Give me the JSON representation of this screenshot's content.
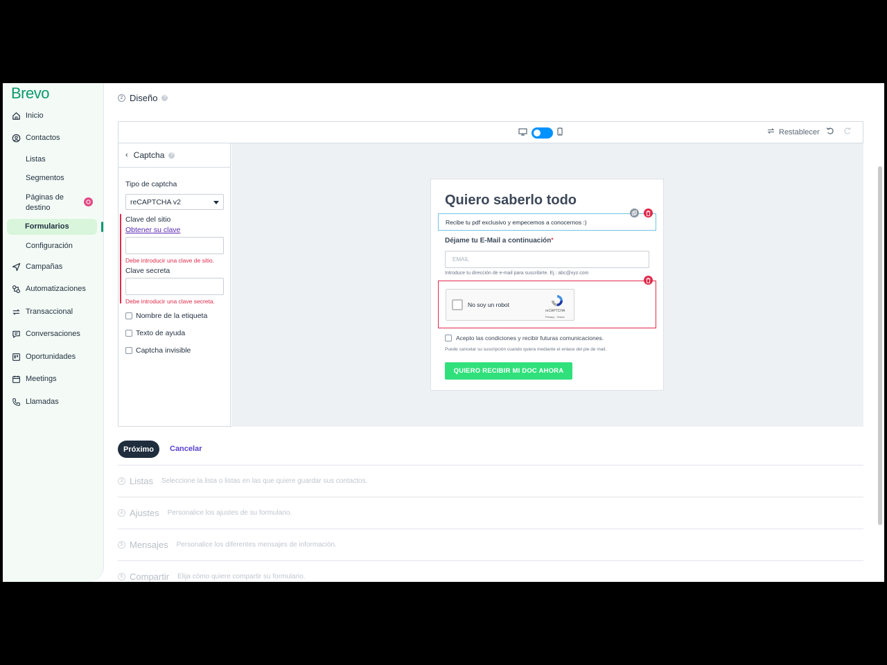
{
  "brand": "Brevo",
  "sidebar": {
    "inicio": "Inicio",
    "contactos": "Contactos",
    "listas": "Listas",
    "segmentos": "Segmentos",
    "paginas_1": "Páginas de",
    "paginas_2": "destino",
    "formularios": "Formularios",
    "configuracion": "Configuración",
    "campanas": "Campañas",
    "automatizaciones": "Automatizaciones",
    "transaccional": "Transaccional",
    "conversaciones": "Conversaciones",
    "oportunidades": "Oportunidades",
    "meetings": "Meetings",
    "llamadas": "Llamadas",
    "active_item": "Formularios",
    "accent": "#0b996e"
  },
  "step2": {
    "num": "2",
    "title": "Diseño"
  },
  "editor": {
    "restablecer": "Restablecer",
    "device_selected": "desktop",
    "panel_title": "Captcha",
    "tipo_label": "Tipo de captcha",
    "tipo_value": "reCAPTCHA v2",
    "site_key_label": "Clave del sitio",
    "site_key_link": "Obtener su clave",
    "site_key_value": "",
    "site_key_error": "Debe introducir una clave de sitio.",
    "secret_label": "Clave secreta",
    "secret_value": "",
    "secret_error": "Debe introducir una clave secreta.",
    "checkboxes": [
      "Nombre de la etiqueta",
      "Texto de ayuda",
      "Captcha invisible"
    ]
  },
  "form": {
    "title": "Quiero saberlo todo",
    "description": "Recibe tu pdf exclusivo y empecemos a conocernos :)",
    "email_label": "Déjame tu E-Mail a continuación",
    "email_required": "*",
    "email_placeholder": "EMAIL",
    "email_help": "Introduce tu dirección de e-mail para suscribirte. Ej.: abc@xyz.com",
    "recaptcha_text": "No soy un robot",
    "recaptcha_brand": "reCAPTCHA",
    "recaptcha_terms": "Privacy - Terms",
    "accept_text": "Acepto las condiciones y recibir futuras comunicaciones.",
    "unsub_text": "Puede cancelar su suscripción cuando quiera mediante el enlace del pie de mail.",
    "submit_label": "QUIERO RECIBIR MI DOC AHORA",
    "submit_color": "#30e07b"
  },
  "actions": {
    "next": "Próximo",
    "cancel": "Cancelar"
  },
  "future_steps": [
    {
      "num": "3",
      "name": "Listas",
      "desc": "Seleccione la lista o listas en las que quiere guardar sus contactos."
    },
    {
      "num": "4",
      "name": "Ajustes",
      "desc": "Personalice los ajustes de su formulario."
    },
    {
      "num": "5",
      "name": "Mensajes",
      "desc": "Personalice los diferentes mensajes de información."
    },
    {
      "num": "6",
      "name": "Compartir",
      "desc": "Elija cómo quiere compartir su formulario."
    }
  ]
}
